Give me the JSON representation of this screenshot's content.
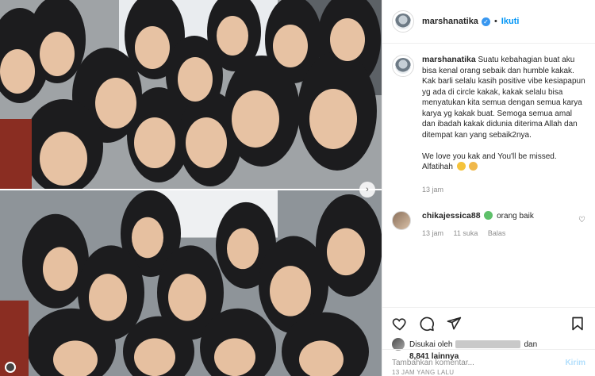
{
  "post": {
    "username": "marshanatika",
    "follow_label": "Ikuti",
    "dot": "•",
    "caption": "Suatu kebahagian buat aku bisa kenal orang sebaik dan humble kakak. Kak barli selalu kasih positive vibe kesiapapun yg ada di circle kakak, kakak selalu bisa menyatukan kita semua dengan semua karya karya yg kakak buat. Semoga semua amal dan ibadah kakak didunia diterima Allah dan ditempat kan yang sebaik2nya.\n\nWe love you kak and You'll be missed. Alfatihah",
    "caption_time": "13 jam"
  },
  "comment": {
    "username": "chikajessica88",
    "text": "orang baik",
    "time": "13 jam",
    "likes": "11 suka",
    "reply": "Balas"
  },
  "likes": {
    "prefix": "Disukai oleh",
    "and": "dan",
    "count": "8,841 lainnya"
  },
  "timestamp": "13 JAM YANG LALU",
  "comment_box": {
    "placeholder": "Tambahkan komentar...",
    "send_label": "Kirim"
  },
  "colors": {
    "accent": "#0095f6",
    "verified": "#3897f0",
    "send_disabled": "#b2dffc"
  }
}
